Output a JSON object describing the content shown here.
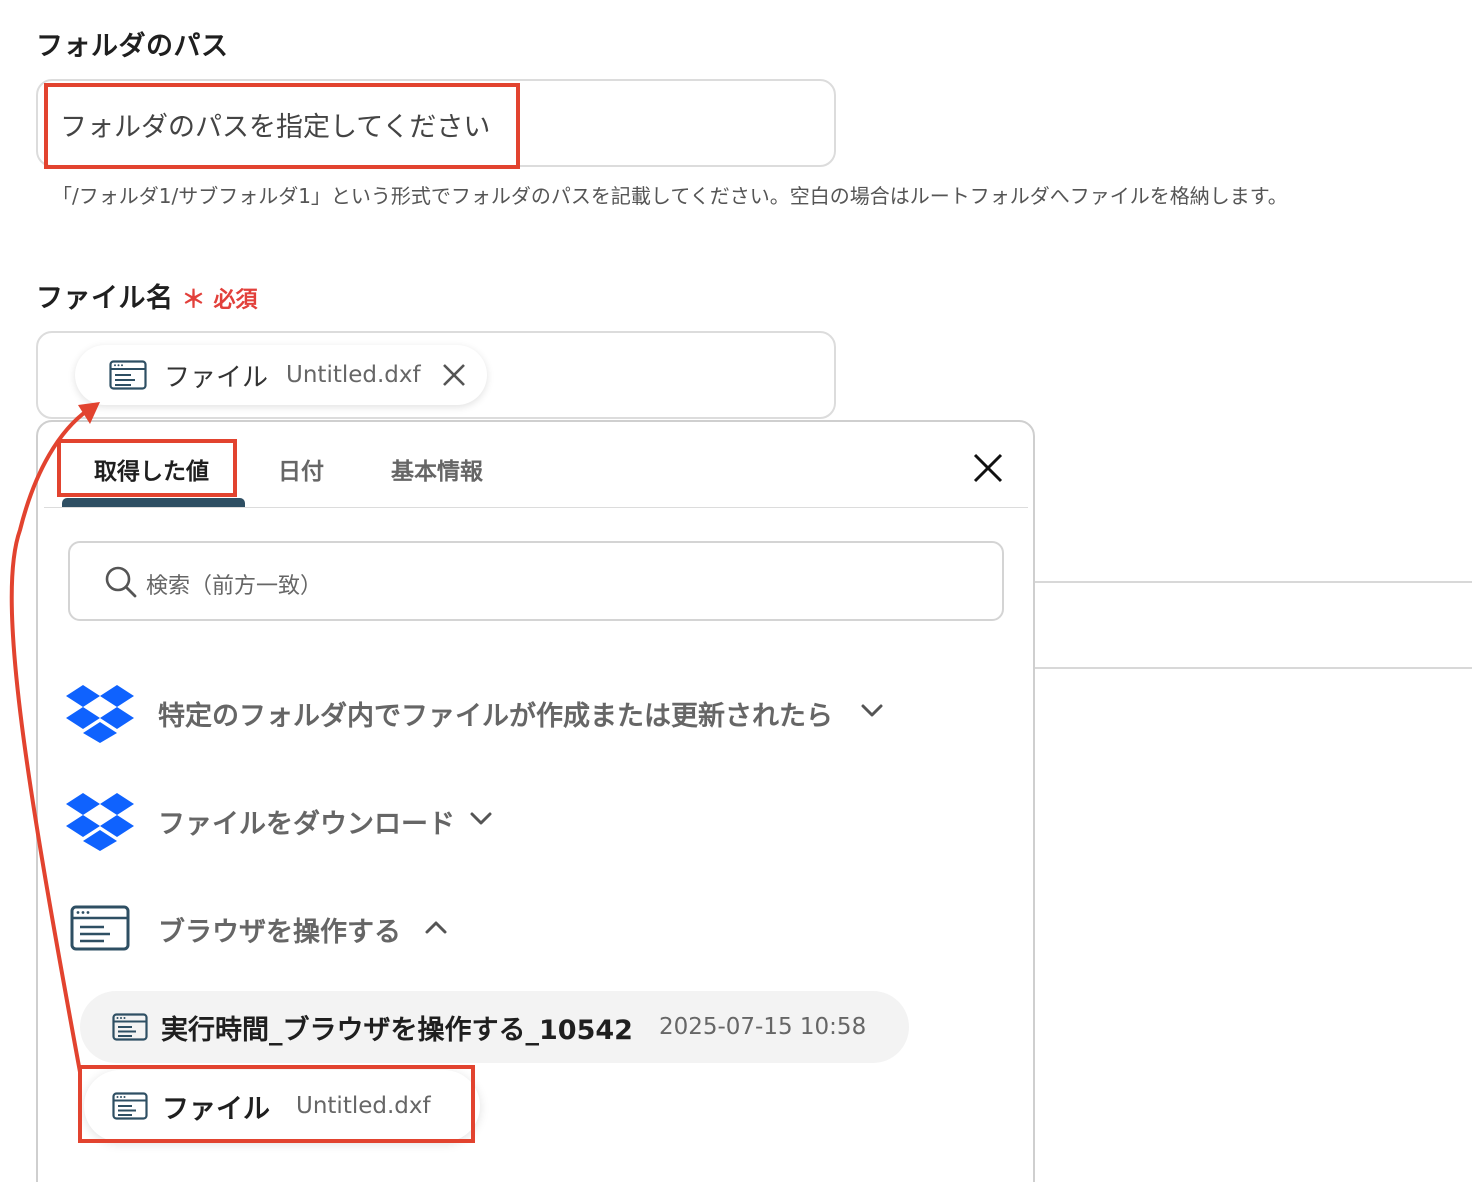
{
  "folder_path": {
    "label": "フォルダのパス",
    "placeholder": "フォルダのパスを指定してください",
    "help": "「/フォルダ1/サブフォルダ1」という形式でフォルダのパスを記載してください。空白の場合はルートフォルダへファイルを格納します。"
  },
  "file_name": {
    "label": "ファイル名",
    "required_mark": "＊",
    "required_text": "必須",
    "chip": {
      "icon": "browser-window-icon",
      "label": "ファイル",
      "value": "Untitled.dxf"
    }
  },
  "panel": {
    "tabs": [
      {
        "label": "取得した値",
        "active": true
      },
      {
        "label": "日付",
        "active": false
      },
      {
        "label": "基本情報",
        "active": false
      }
    ],
    "search_placeholder": "検索（前方一致）",
    "groups": [
      {
        "icon": "dropbox-icon",
        "label": "特定のフォルダ内でファイルが作成または更新されたら",
        "expanded": false
      },
      {
        "icon": "dropbox-icon",
        "label": "ファイルをダウンロード",
        "expanded": false
      },
      {
        "icon": "browser-window-icon",
        "label": "ブラウザを操作する",
        "expanded": true
      }
    ],
    "items": [
      {
        "icon": "browser-window-icon",
        "label": "実行時間_ブラウザを操作する_10542",
        "value": "2025-07-15 10:58"
      },
      {
        "icon": "browser-window-icon",
        "label": "ファイル",
        "value": "Untitled.dxf"
      }
    ]
  },
  "colors": {
    "accent_red": "#e2432f",
    "tab_indicator": "#2e4f63",
    "dropbox_blue": "#0f62fe",
    "icon_stroke": "#2e4f63"
  }
}
